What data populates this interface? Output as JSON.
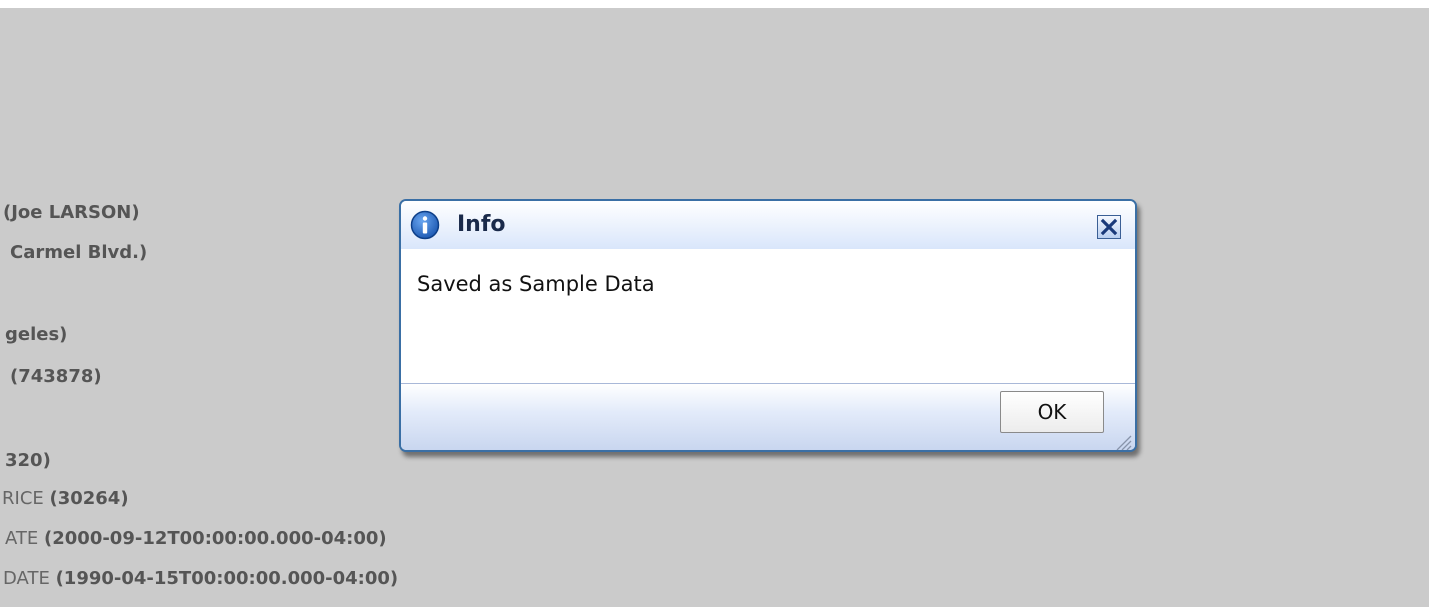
{
  "background": {
    "lines": [
      {
        "label": "",
        "value": "(Joe LARSON)"
      },
      {
        "label": "",
        "value": "Carmel Blvd.)"
      },
      {
        "label": "",
        "value": "geles)"
      },
      {
        "label": "",
        "value": "(743878)"
      },
      {
        "label": "",
        "value": "320)"
      },
      {
        "label": "RICE ",
        "value": "(30264)"
      },
      {
        "label": "ATE ",
        "value": "(2000-09-12T00:00:00.000-04:00)"
      },
      {
        "label": "DATE ",
        "value": "(1990-04-15T00:00:00.000-04:00)"
      }
    ]
  },
  "dialog": {
    "title": "Info",
    "message": "Saved as Sample Data",
    "ok_label": "OK",
    "icon": "info-icon",
    "close_icon": "close-icon"
  },
  "colors": {
    "overlay": "#cbcbcb",
    "dialog_border": "#3a6fa5",
    "info_icon": "#1f5fb8"
  }
}
